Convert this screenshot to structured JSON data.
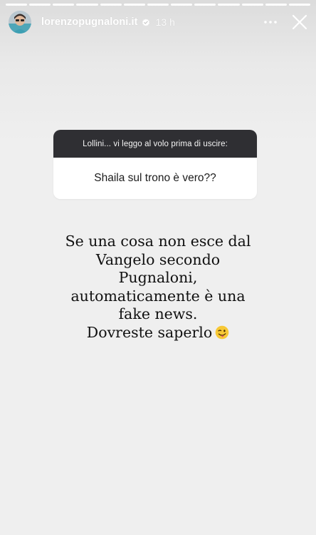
{
  "story": {
    "progress": {
      "segments_total": 13,
      "segments_viewed": 13
    },
    "header": {
      "username": "lorenzopugnaloni.it",
      "verified": true,
      "timestamp": "13 h",
      "more_icon": "more-horizontal-icon",
      "close_icon": "close-icon"
    },
    "question_sticker": {
      "prompt": "Lollini... vi leggo al volo prima di uscire:",
      "answer": "Shaila sul trono è vero??"
    },
    "caption": {
      "lines": [
        "Se una cosa non esce dal",
        "Vangelo secondo",
        "Pugnaloni,",
        "automaticamente è una",
        "fake news.",
        "Dovreste saperlo"
      ],
      "emoji": "winking-face-tongue-emoji"
    }
  }
}
